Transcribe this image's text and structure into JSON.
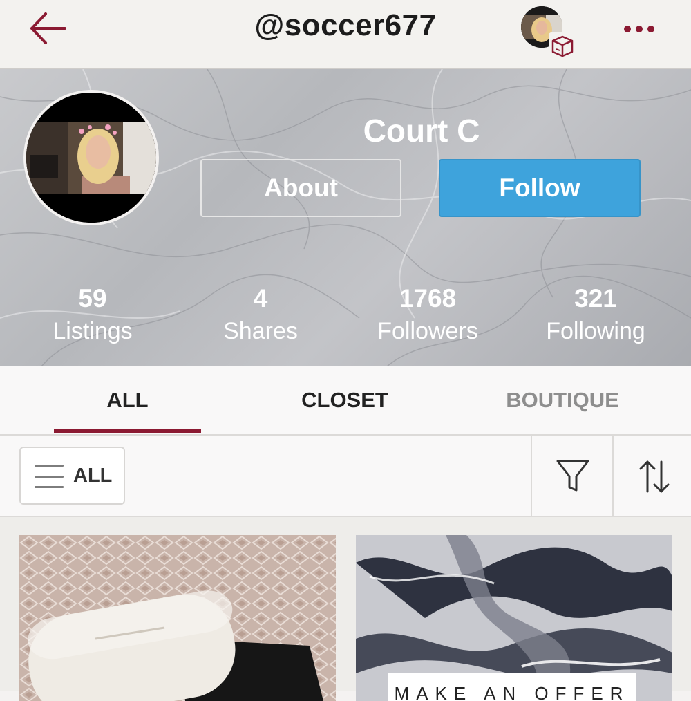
{
  "header": {
    "username": "@soccer677"
  },
  "profile": {
    "display_name": "Court C",
    "about_label": "About",
    "follow_label": "Follow"
  },
  "stats": [
    {
      "value": "59",
      "label": "Listings"
    },
    {
      "value": "4",
      "label": "Shares"
    },
    {
      "value": "1768",
      "label": "Followers"
    },
    {
      "value": "321",
      "label": "Following"
    }
  ],
  "tabs": [
    {
      "label": "ALL",
      "active": true
    },
    {
      "label": "CLOSET",
      "active": false
    },
    {
      "label": "BOUTIQUE",
      "active": false
    }
  ],
  "filter_bar": {
    "category_label": "ALL"
  },
  "listings": [
    {
      "image": "white-glasses-case-photo"
    },
    {
      "image": "marble-background-photo",
      "overlay_text": "MAKE AN OFFER"
    }
  ],
  "colors": {
    "accent": "#8b1a32",
    "follow_button": "#3ea3dc",
    "active_tab_text": "#222222",
    "inactive_tab_text": "#8e8e8e"
  }
}
